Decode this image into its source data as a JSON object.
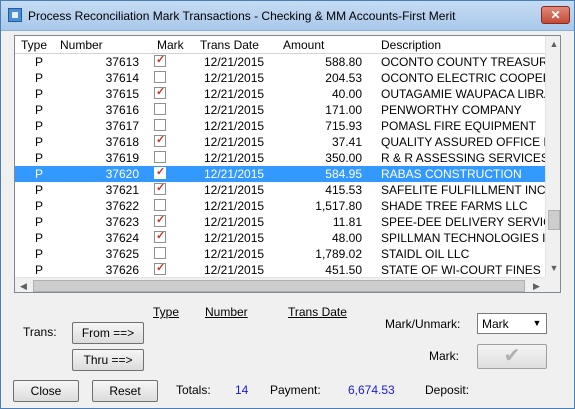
{
  "window": {
    "title": "Process Reconciliation Mark Transactions -  Checking & MM Accounts-First Merit",
    "close_glyph": "✕"
  },
  "grid": {
    "columns": [
      "Type",
      "Number",
      "Mark",
      "Trans Date",
      "Amount",
      "Description"
    ],
    "rows": [
      {
        "type": "P",
        "number": "37613",
        "marked": true,
        "date": "12/21/2015",
        "amount": "588.80",
        "description": "OCONTO COUNTY TREASURER"
      },
      {
        "type": "P",
        "number": "37614",
        "marked": false,
        "date": "12/21/2015",
        "amount": "204.53",
        "description": "OCONTO ELECTRIC COOPERATIVE"
      },
      {
        "type": "P",
        "number": "37615",
        "marked": true,
        "date": "12/21/2015",
        "amount": "40.00",
        "description": "OUTAGAMIE WAUPACA LIBRARY"
      },
      {
        "type": "P",
        "number": "37616",
        "marked": false,
        "date": "12/21/2015",
        "amount": "171.00",
        "description": "PENWORTHY COMPANY"
      },
      {
        "type": "P",
        "number": "37617",
        "marked": false,
        "date": "12/21/2015",
        "amount": "715.93",
        "description": "POMASL FIRE EQUIPMENT"
      },
      {
        "type": "P",
        "number": "37618",
        "marked": true,
        "date": "12/21/2015",
        "amount": "37.41",
        "description": "QUALITY ASSURED OFFICE MACHINES"
      },
      {
        "type": "P",
        "number": "37619",
        "marked": false,
        "date": "12/21/2015",
        "amount": "350.00",
        "description": "R & R ASSESSING SERVICES"
      },
      {
        "type": "P",
        "number": "37620",
        "marked": true,
        "date": "12/21/2015",
        "amount": "584.95",
        "description": "RABAS CONSTRUCTION",
        "selected": true
      },
      {
        "type": "P",
        "number": "37621",
        "marked": true,
        "date": "12/21/2015",
        "amount": "415.53",
        "description": "SAFELITE FULFILLMENT INC."
      },
      {
        "type": "P",
        "number": "37622",
        "marked": false,
        "date": "12/21/2015",
        "amount": "1,517.80",
        "description": "SHADE TREE FARMS LLC"
      },
      {
        "type": "P",
        "number": "37623",
        "marked": true,
        "date": "12/21/2015",
        "amount": "11.81",
        "description": "SPEE-DEE DELIVERY SERVICE"
      },
      {
        "type": "P",
        "number": "37624",
        "marked": true,
        "date": "12/21/2015",
        "amount": "48.00",
        "description": "SPILLMAN TECHNOLOGIES INC"
      },
      {
        "type": "P",
        "number": "37625",
        "marked": false,
        "date": "12/21/2015",
        "amount": "1,789.02",
        "description": "STAIDL OIL LLC"
      },
      {
        "type": "P",
        "number": "37626",
        "marked": true,
        "date": "12/21/2015",
        "amount": "451.50",
        "description": "STATE OF WI-COURT FINES"
      }
    ],
    "check_glyph": "✓"
  },
  "filter": {
    "col_type": "Type",
    "col_number": "Number",
    "col_date": "Trans Date",
    "trans_label": "Trans:",
    "from_button": "From ==>",
    "thru_button": "Thru ==>"
  },
  "mark_controls": {
    "mark_unmark_label": "Mark/Unmark:",
    "mark_unmark_value": "Mark",
    "mark_label": "Mark:",
    "mark_button_glyph": "✔"
  },
  "footer": {
    "close_button": "Close",
    "reset_button": "Reset",
    "totals_label": "Totals:",
    "totals_value": "14",
    "payment_label": "Payment:",
    "payment_value": "6,674.53",
    "deposit_label": "Deposit:"
  },
  "colors": {
    "selection": "#3399ff",
    "value_blue": "#1b1bd2",
    "check_red": "#c0382b"
  }
}
